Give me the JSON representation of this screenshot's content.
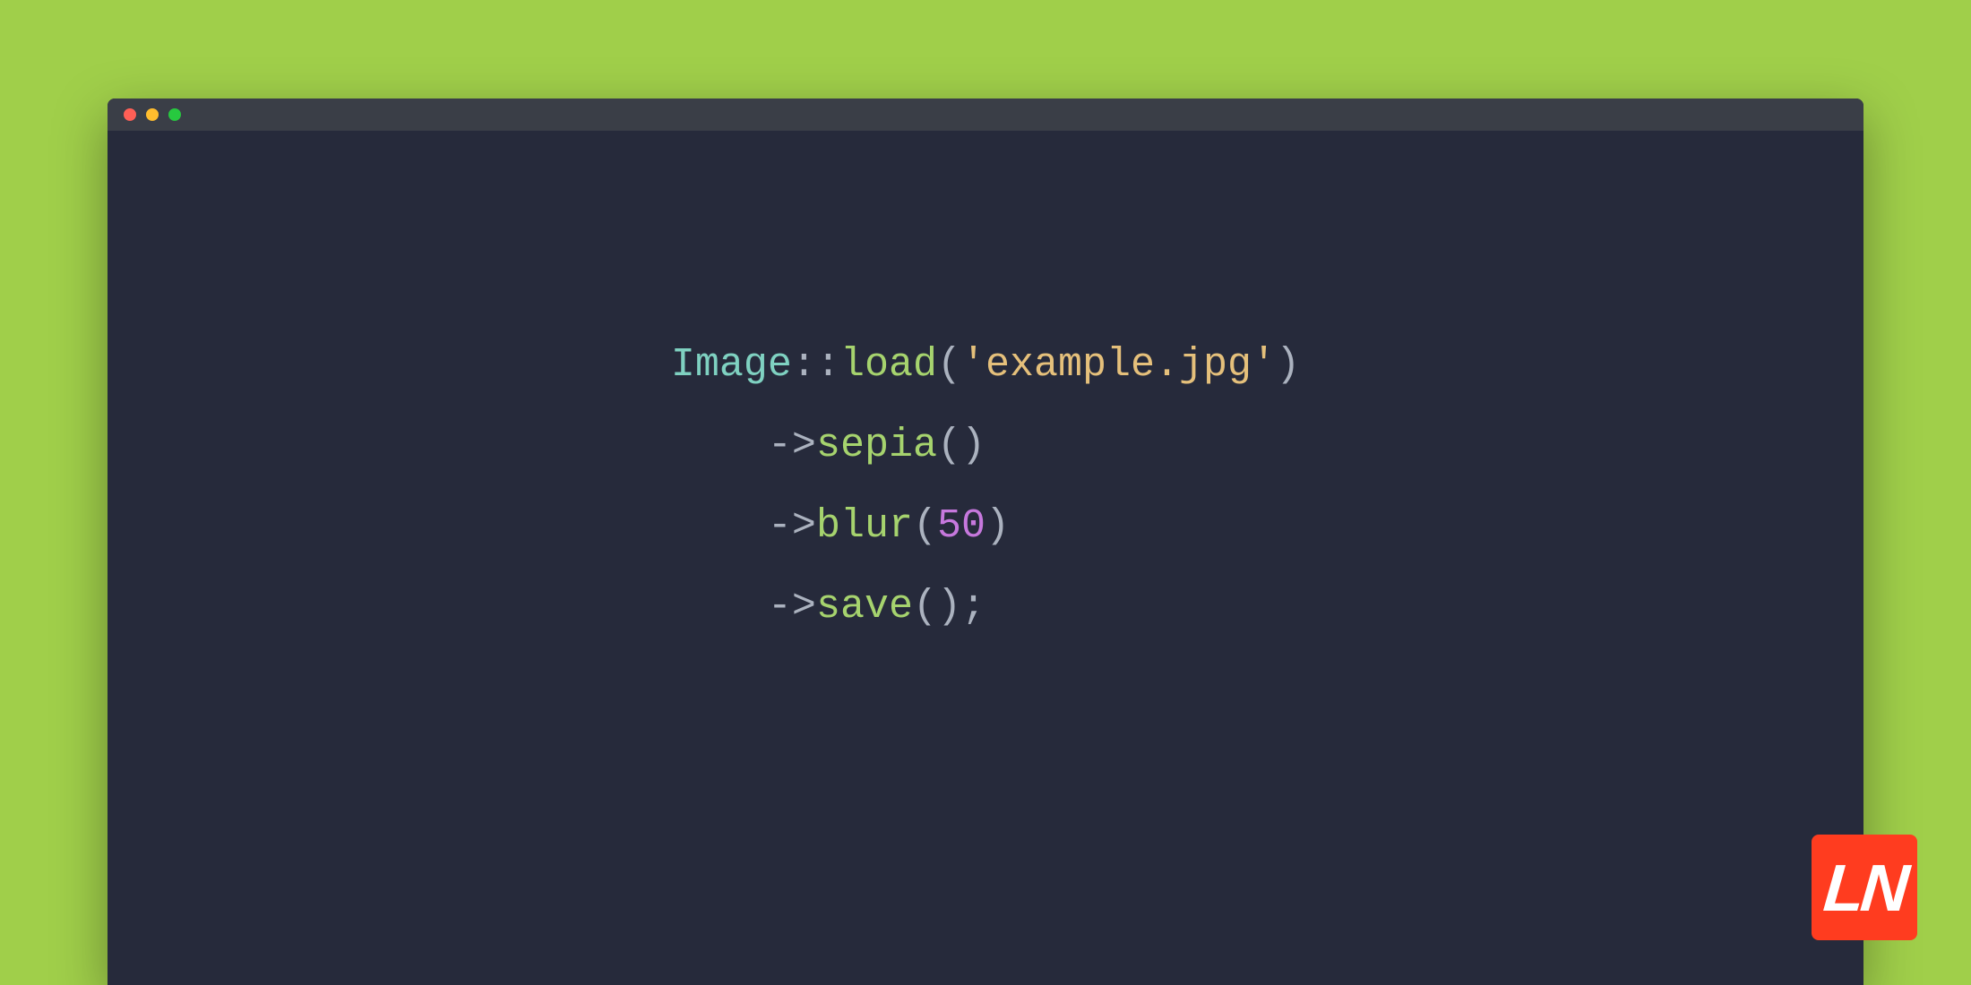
{
  "code": {
    "line1": {
      "class": "Image",
      "scope": "::",
      "func": "load",
      "open": "(",
      "quote1": "'",
      "string": "example.jpg",
      "quote2": "'",
      "close": ")"
    },
    "line2": {
      "indent": "    ",
      "arrow": "->",
      "func": "sepia",
      "parens": "()"
    },
    "line3": {
      "indent": "    ",
      "arrow": "->",
      "func": "blur",
      "open": "(",
      "num": "50",
      "close": ")"
    },
    "line4": {
      "indent": "    ",
      "arrow": "->",
      "func": "save",
      "parens": "()",
      "semi": ";"
    }
  },
  "logo": {
    "text": "LN"
  }
}
